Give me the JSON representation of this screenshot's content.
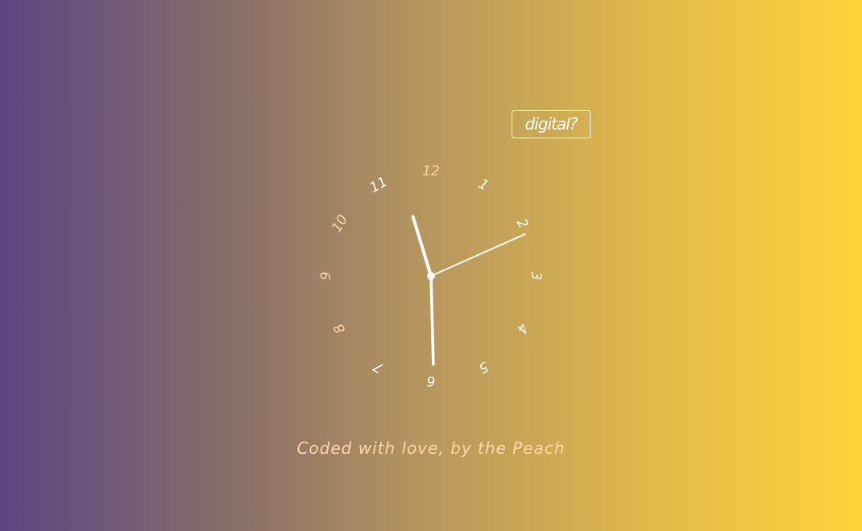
{
  "toggle": {
    "label": "digital?"
  },
  "clock": {
    "numerals": [
      "12",
      "1",
      "2",
      "3",
      "4",
      "5",
      "6",
      "7",
      "8",
      "9",
      "10",
      "11"
    ],
    "numeral_colors": [
      "#ffd6a6",
      "#ffffff",
      "#ffffff",
      "#ffffff",
      "#ffffff",
      "#ffffff",
      "#ffffff",
      "#ffffff",
      "#ffd6a6",
      "#ffd6a6",
      "#ffd6a6",
      "#ffffff"
    ],
    "time": {
      "hour": 5,
      "minute": 57,
      "second": 11
    },
    "hand_color": "#ffffff"
  },
  "footer": {
    "credit": "Coded with love, by the Peach"
  },
  "colors": {
    "gradient_start": "#5c4583",
    "gradient_end": "#ffd43a",
    "accent_text": "#ffd6a6"
  }
}
